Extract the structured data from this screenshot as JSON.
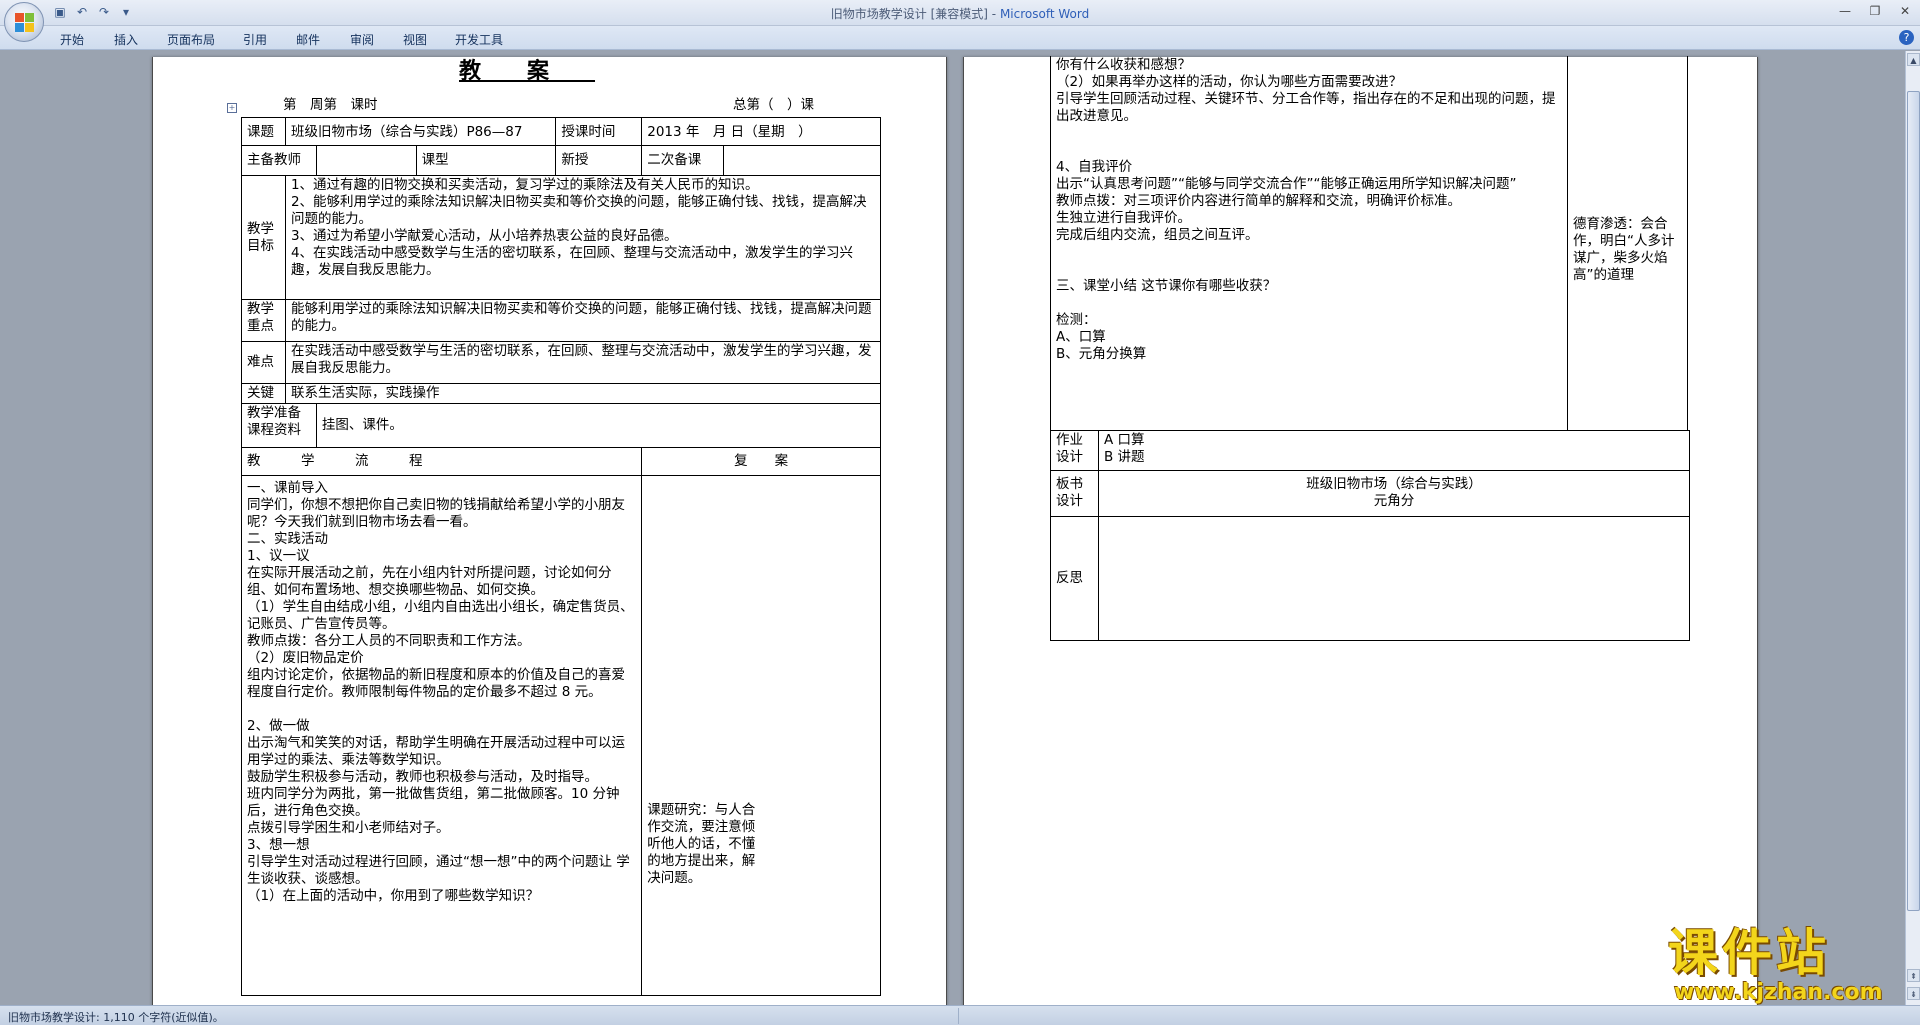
{
  "window": {
    "title_doc": "旧物市场教学设计 [兼容模式]",
    "title_sep": " - ",
    "title_app": "Microsoft Word"
  },
  "ribbon": {
    "tabs": [
      "开始",
      "插入",
      "页面布局",
      "引用",
      "邮件",
      "审阅",
      "视图",
      "开发工具"
    ]
  },
  "status": {
    "text": "旧物市场教学设计: 1,110 个字符(近似值)。"
  },
  "left_page": {
    "title": "教案",
    "week_line_a": "第　周第　课时",
    "week_line_b": "总第（　）课",
    "table": {
      "subject_label": "课题",
      "subject_value": "班级旧物市场（综合与实践）P86—87",
      "time_label": "授课时间",
      "time_value": "2013 年　月 日（星期　）",
      "teacher_label": "主备教师",
      "type_label": "课型",
      "type_value": "新授",
      "prep_label": "二次备课",
      "goal_label": "教学目标",
      "goals": [
        "1、通过有趣的旧物交换和买卖活动，复习学过的乘除法及有关人民币的知识。",
        "2、能够利用学过的乘除法知识解决旧物买卖和等价交换的问题，能够正确付钱、找钱，提高解决问题的能力。",
        "3、通过为希望小学献爱心活动，从小培养热衷公益的良好品德。",
        "4、在实践活动中感受数学与生活的密切联系，在回顾、整理与交流活动中，激发学生的学习兴趣，发展自我反思能力。"
      ],
      "key_label": "教学重点",
      "key_value": "能够利用学过的乘除法知识解决旧物买卖和等价交换的问题，能够正确付钱、找钱，提高解决问题的能力。",
      "diff_label": "难点",
      "diff_value": "在实践活动中感受数学与生活的密切联系，在回顾、整理与交流活动中，激发学生的学习兴趣，发展自我反思能力。",
      "crux_label": "关键",
      "crux_value": "联系生活实际，实践操作",
      "prep_mat_label": "教学准备课程资料",
      "prep_mat_value": "挂图、课件。",
      "flow_header": "教　　　学　　　流　　　程",
      "review_header": "复　　案",
      "flow_lines": [
        "一、课前导入",
        "同学们，你想不想把你自己卖旧物的钱捐献给希望小学的小朋友呢？今天我们就到旧物市场去看一看。",
        "二、实践活动",
        "1、议一议",
        "在实际开展活动之前，先在小组内针对所提问题，讨论如何分组、如何布置场地、想交换哪些物品、如何交换。",
        "（1）学生自由结成小组，小组内自由选出小组长，确定售货员、记账员、广告宣传员等。",
        "教师点拨：各分工人员的不同职责和工作方法。",
        "（2）废旧物品定价",
        "组内讨论定价，依据物品的新旧程度和原本的价值及自己的喜爱程度自行定价。教师限制每件物品的定价最多不超过 8 元。",
        "",
        "2、做一做",
        "出示淘气和笑笑的对话，帮助学生明确在开展活动过程中可以运用学过的乘法、乘法等数学知识。",
        "鼓励学生积极参与活动，教师也积极参与活动，及时指导。",
        "班内同学分为两批，第一批做售货组，第二批做顾客。10 分钟后，进行角色交换。",
        "点拨引导学困生和小老师结对子。",
        "3、想一想",
        "引导学生对活动过程进行回顾，通过“想一想”中的两个问题让 学生谈收获、谈感想。",
        "（1）在上面的活动中，你用到了哪些数学知识？"
      ],
      "review_note": "课题研究：与人合作交流，要注意倾听他人的话，不懂的地方提出来，解决问题。"
    }
  },
  "right_page": {
    "flow_lines": [
      "你有什么收获和感想？",
      "（2）如果再举办这样的活动，你认为哪些方面需要改进？",
      "引导学生回顾活动过程、关键环节、分工合作等，指出存在的不足和出现的问题，提出改进意见。",
      "",
      "4、自我评价",
      "出示“认真思考问题”“能够与同学交流合作”“能够正确运用所学知识解决问题”",
      "教师点拨：对三项评价内容进行简单的解释和交流，明确评价标准。",
      "生独立进行自我评价。",
      "完成后组内交流，组员之间互评。",
      "",
      "",
      "三、课堂小结 这节课你有哪些收获？",
      "",
      "检测：",
      "A、口算",
      "B、元角分换算"
    ],
    "moral_note": "德育渗透：会合作，明白“人多计谋广，柴多火焰高”的道理",
    "homework_label": "作业设计",
    "homework_lines": [
      "A 口算",
      "B 讲题"
    ],
    "board_label": "板书设计",
    "board_lines": [
      "班级旧物市场（综合与实践）",
      "元角分"
    ],
    "reflect_label": "反思"
  },
  "watermark": {
    "title": "课件站",
    "url": "www.kjzhan.com"
  }
}
